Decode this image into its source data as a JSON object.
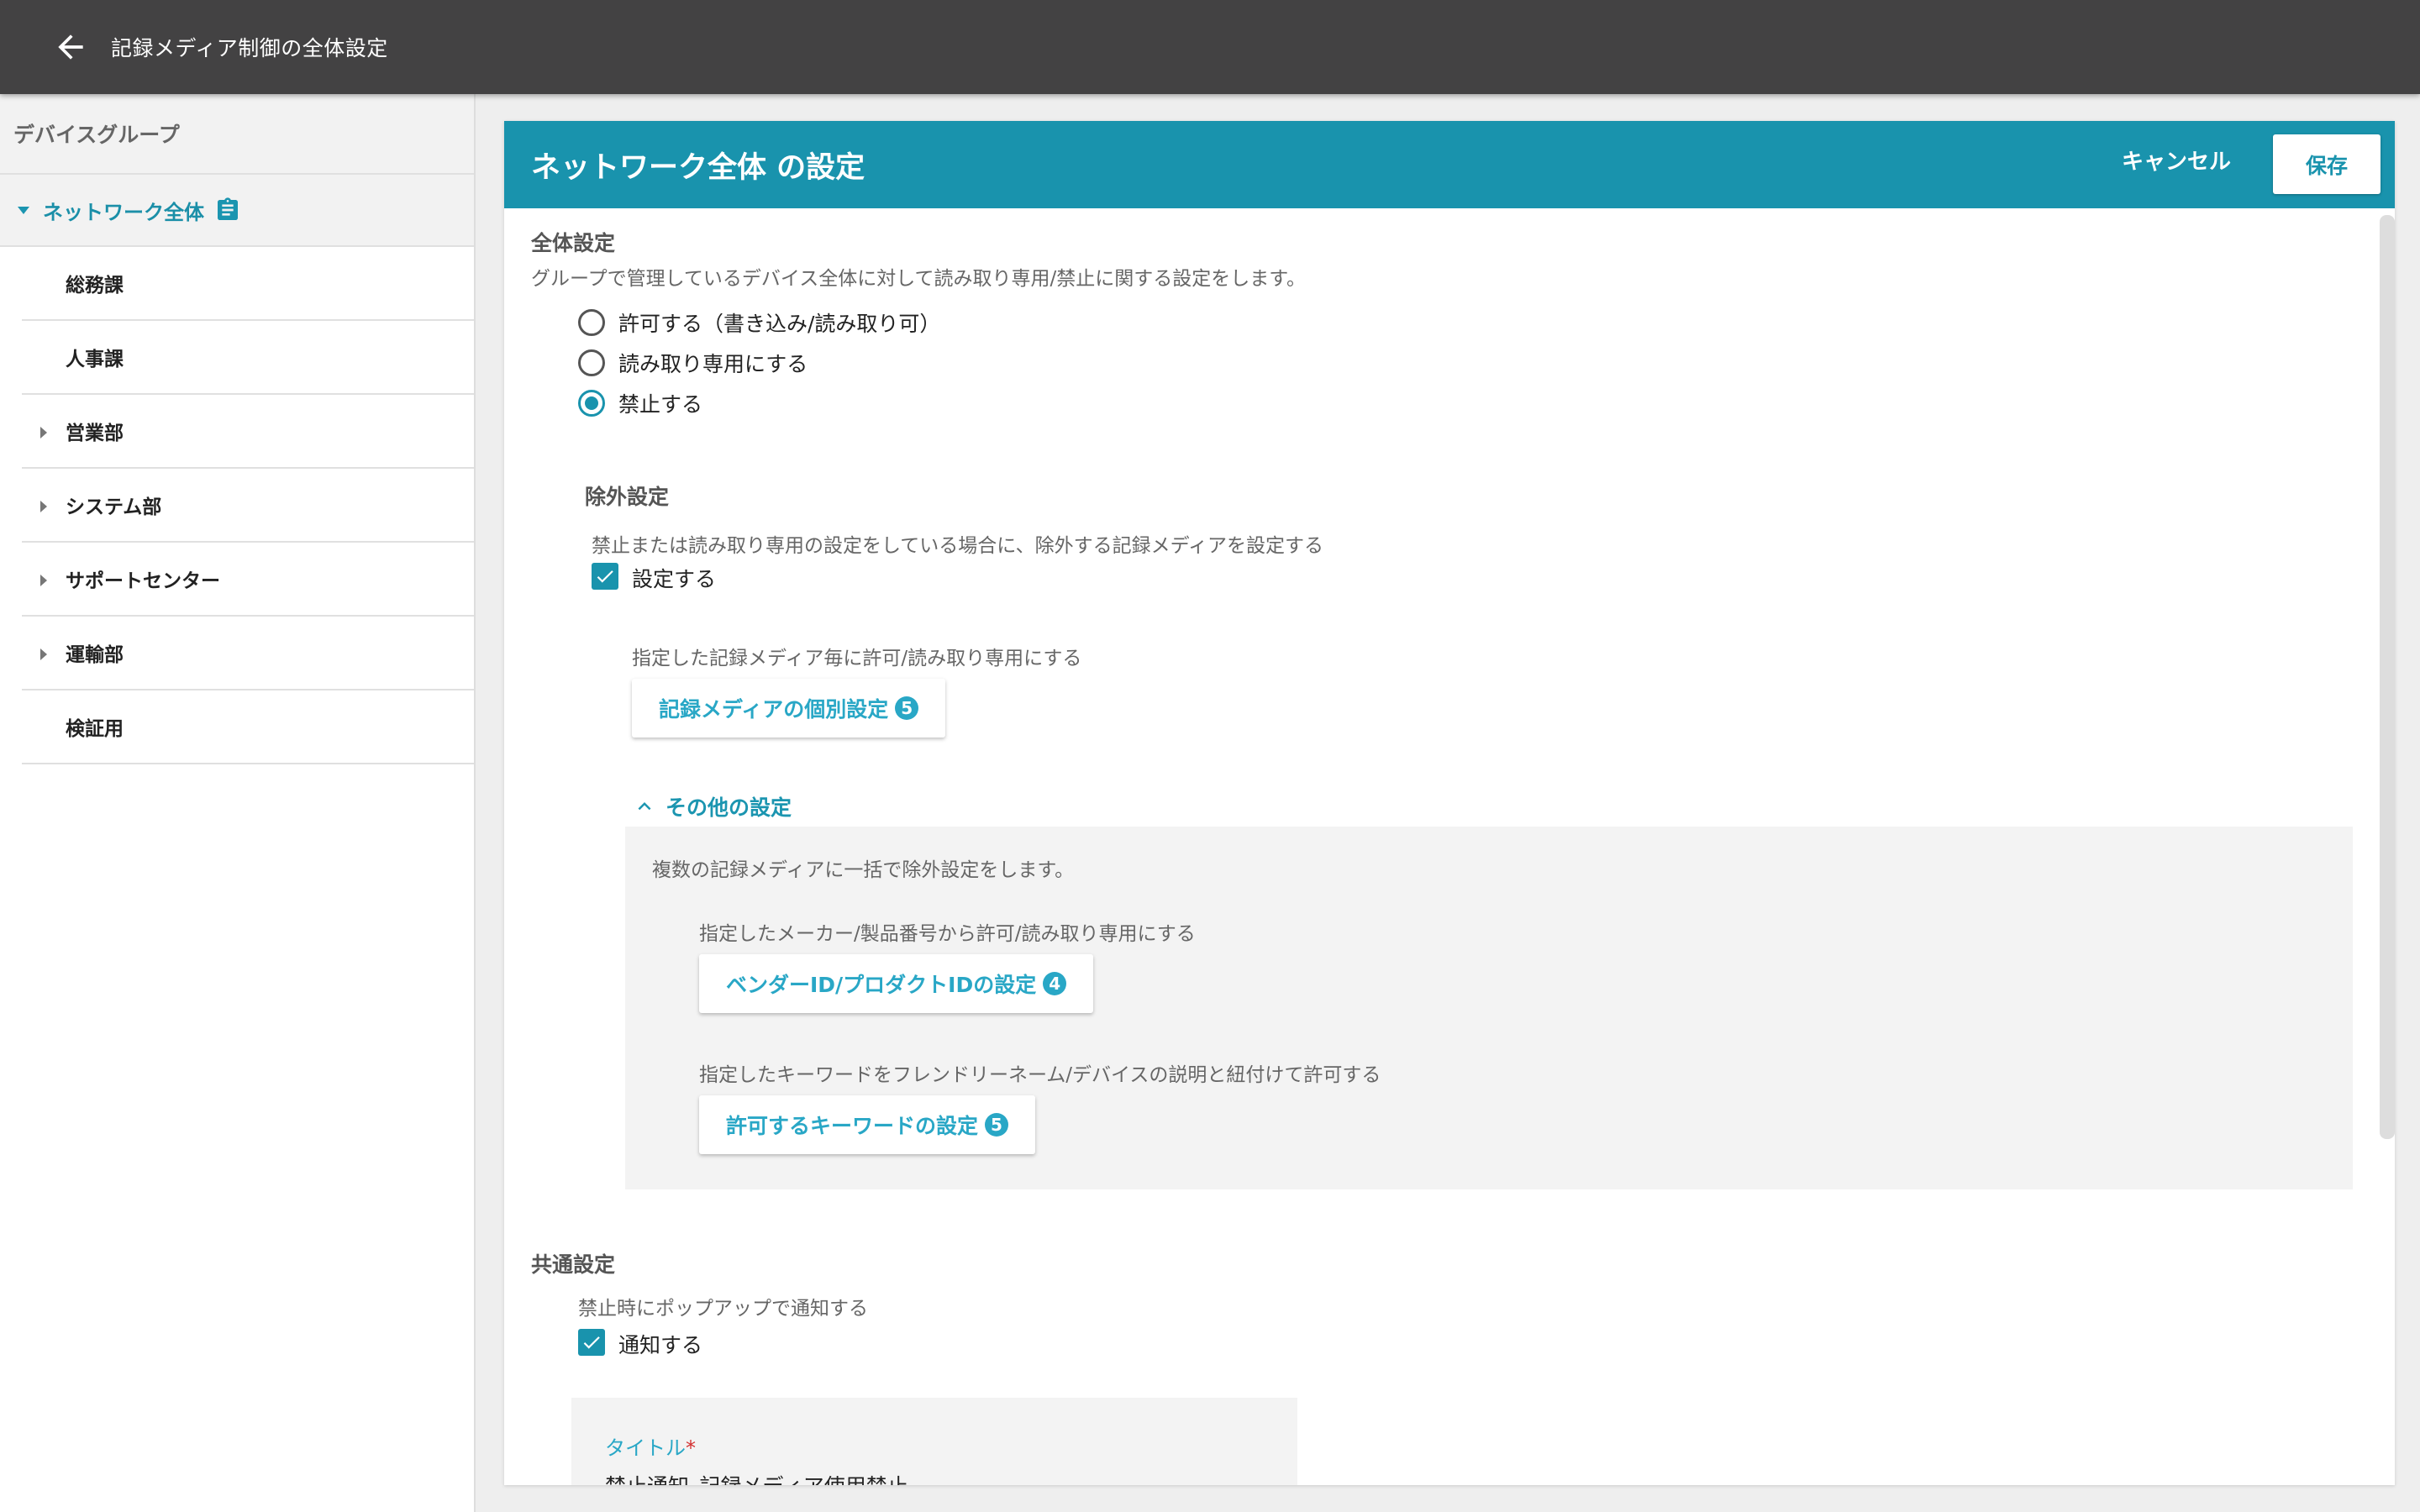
{
  "app": {
    "title": "記録メディア制御の全体設定"
  },
  "sidebar": {
    "header": "デバイスグループ",
    "root": {
      "label": "ネットワーク全体"
    },
    "items": [
      {
        "label": "総務課",
        "expandable": false
      },
      {
        "label": "人事課",
        "expandable": false
      },
      {
        "label": "営業部",
        "expandable": true
      },
      {
        "label": "システム部",
        "expandable": true
      },
      {
        "label": "サポートセンター",
        "expandable": true
      },
      {
        "label": "運輸部",
        "expandable": true
      },
      {
        "label": "検証用",
        "expandable": false
      }
    ]
  },
  "panel": {
    "title": "ネットワーク全体 の設定",
    "cancel_label": "キャンセル",
    "save_label": "保存"
  },
  "overall": {
    "heading": "全体設定",
    "description": "グループで管理しているデバイス全体に対して読み取り専用/禁止に関する設定をします。",
    "options": [
      {
        "label": "許可する（書き込み/読み取り可）",
        "selected": false
      },
      {
        "label": "読み取り専用にする",
        "selected": false
      },
      {
        "label": "禁止する",
        "selected": true
      }
    ]
  },
  "exclusion": {
    "heading": "除外設定",
    "description": "禁止または読み取り専用の設定をしている場合に、除外する記録メディアを設定する",
    "checkbox_label": "設定する",
    "checked": true,
    "individual_desc": "指定した記録メディア毎に許可/読み取り専用にする",
    "individual_button": "記録メディアの個別設定",
    "individual_count": "5",
    "other_toggle": "その他の設定",
    "other_desc": "複数の記録メディアに一括で除外設定をします。",
    "vendor_desc": "指定したメーカー/製品番号から許可/読み取り専用にする",
    "vendor_button": "ベンダーID/プロダクトIDの設定",
    "vendor_count": "4",
    "keyword_desc": "指定したキーワードをフレンドリーネーム/デバイスの説明と紐付けて許可する",
    "keyword_button": "許可するキーワードの設定",
    "keyword_count": "5"
  },
  "common": {
    "heading": "共通設定",
    "description": "禁止時にポップアップで通知する",
    "checkbox_label": "通知する",
    "checked": true,
    "title_field_label": "タイトル",
    "title_required_mark": "*",
    "title_value": "禁止通知_記録メディア使用禁止"
  },
  "colors": {
    "topbar": "#434243",
    "accent": "#1993ad",
    "link": "#29a7c6"
  }
}
